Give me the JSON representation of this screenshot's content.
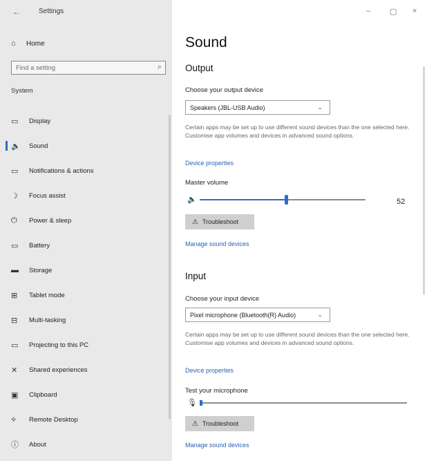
{
  "window": {
    "title": "Settings",
    "back_icon": "back-arrow-icon",
    "minimize": "–",
    "maximize": "▢",
    "close": "×"
  },
  "sidebar": {
    "home_label": "Home",
    "search_placeholder": "Find a setting",
    "section_label": "System",
    "items": [
      {
        "label": "Display",
        "icon": "display-icon",
        "glyph": "▭"
      },
      {
        "label": "Sound",
        "icon": "speaker-icon",
        "glyph": "🔈",
        "selected": true
      },
      {
        "label": "Notifications & actions",
        "icon": "notifications-icon",
        "glyph": "▭"
      },
      {
        "label": "Focus assist",
        "icon": "moon-icon",
        "glyph": "☽"
      },
      {
        "label": "Power & sleep",
        "icon": "power-icon",
        "glyph": "⏻"
      },
      {
        "label": "Battery",
        "icon": "battery-icon",
        "glyph": "▭"
      },
      {
        "label": "Storage",
        "icon": "storage-icon",
        "glyph": "▬"
      },
      {
        "label": "Tablet mode",
        "icon": "tablet-icon",
        "glyph": "⊞"
      },
      {
        "label": "Multi-tasking",
        "icon": "multitasking-icon",
        "glyph": "⊟"
      },
      {
        "label": "Projecting to this PC",
        "icon": "projecting-icon",
        "glyph": "▭"
      },
      {
        "label": "Shared experiences",
        "icon": "shared-experiences-icon",
        "glyph": "✕"
      },
      {
        "label": "Clipboard",
        "icon": "clipboard-icon",
        "glyph": "▣"
      },
      {
        "label": "Remote Desktop",
        "icon": "remote-desktop-icon",
        "glyph": "⟡"
      },
      {
        "label": "About",
        "icon": "info-icon",
        "glyph": "ⓘ"
      }
    ]
  },
  "main": {
    "title": "Sound",
    "output": {
      "heading": "Output",
      "device_label": "Choose your output device",
      "device_value": "Speakers (JBL-USB Audio)",
      "description": "Certain apps may be set up to use different sound devices than the one selected here. Customise app volumes and devices in advanced sound options.",
      "properties_link": "Device properties",
      "volume_label": "Master volume",
      "volume_value": "52",
      "volume_fraction": 0.52,
      "troubleshoot_label": "Troubleshoot",
      "manage_link": "Manage sound devices"
    },
    "input": {
      "heading": "Input",
      "device_label": "Choose your input device",
      "device_value": "Pixel microphone (Bluetooth(R) Audio)",
      "description": "Certain apps may be set up to use different sound devices than the one selected here. Customise app volumes and devices in advanced sound options.",
      "properties_link": "Device properties",
      "test_label": "Test your microphone",
      "troubleshoot_label": "Troubleshoot",
      "manage_link": "Manage sound devices"
    }
  }
}
